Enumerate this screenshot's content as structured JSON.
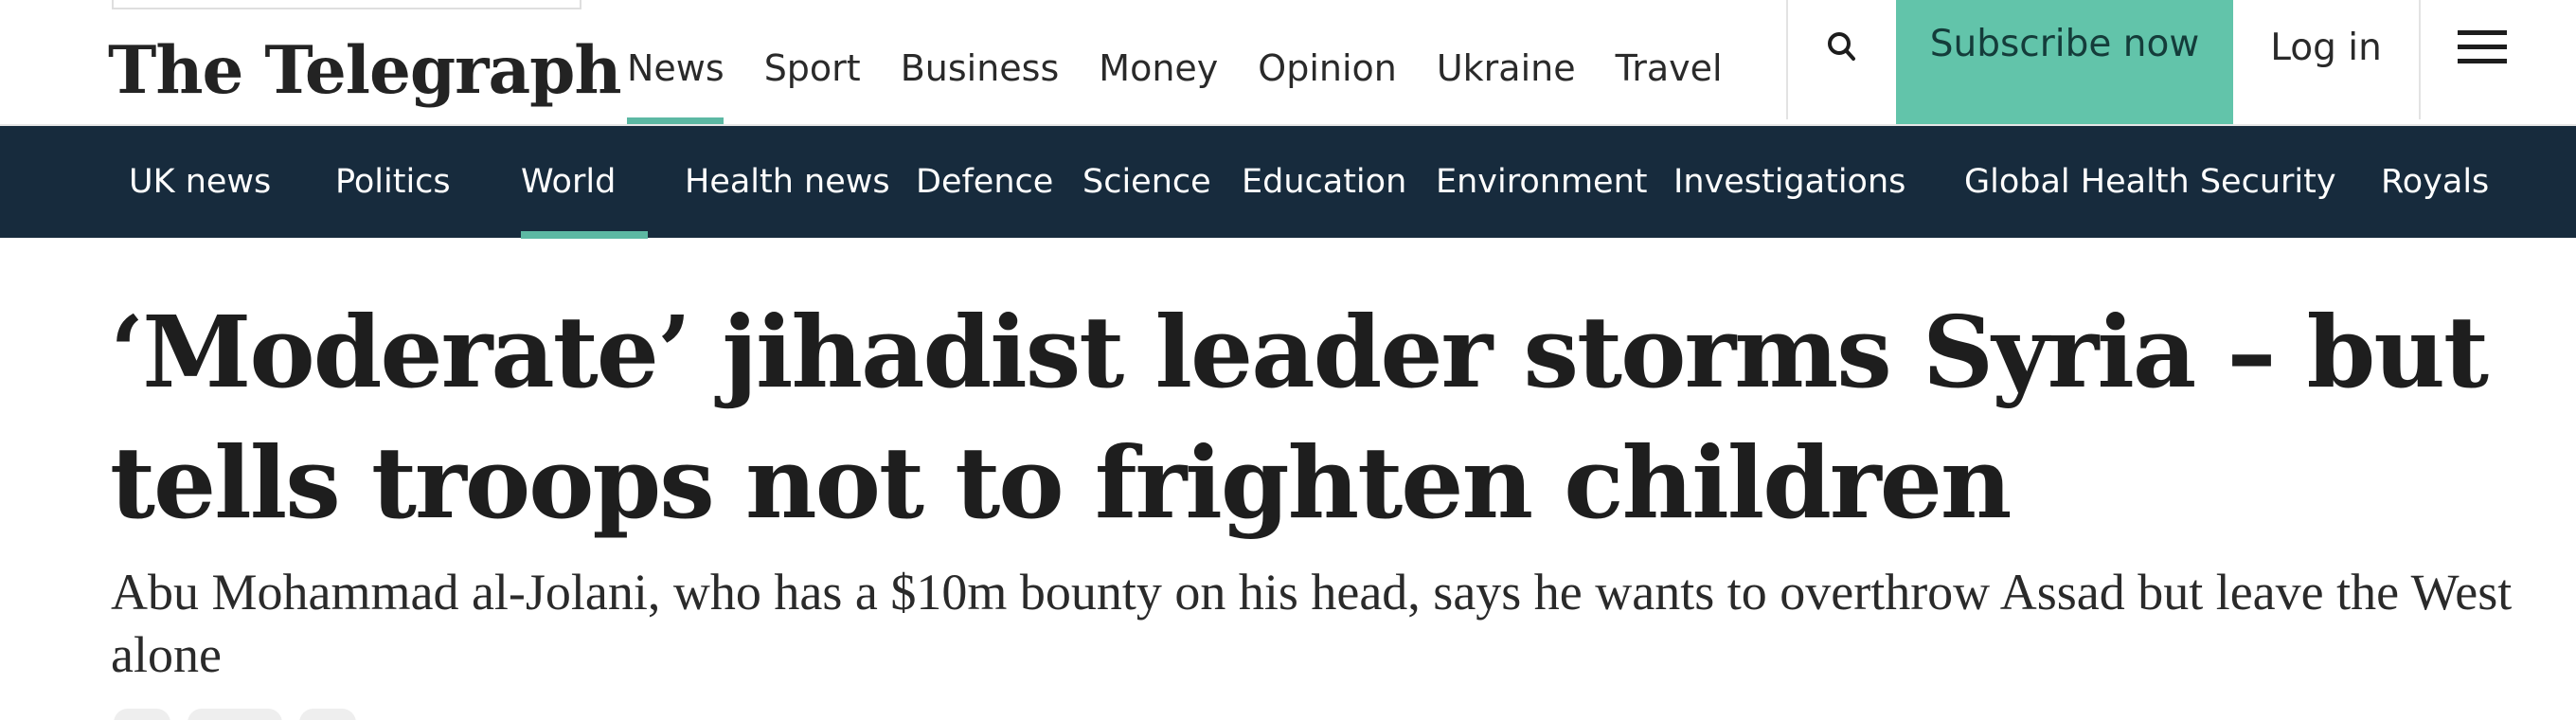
{
  "header": {
    "logo_text": "The Telegraph",
    "primary_nav": [
      {
        "label": "News",
        "active": true
      },
      {
        "label": "Sport"
      },
      {
        "label": "Business"
      },
      {
        "label": "Money"
      },
      {
        "label": "Opinion"
      },
      {
        "label": "Ukraine"
      },
      {
        "label": "Travel"
      }
    ],
    "search_icon": "search-icon",
    "subscribe_label": "Subscribe now",
    "login_label": "Log in",
    "menu_icon": "hamburger-menu-icon"
  },
  "section_nav": {
    "items": [
      {
        "label": "UK news"
      },
      {
        "label": "Politics"
      },
      {
        "label": "World",
        "active": true
      },
      {
        "label": "Health news"
      },
      {
        "label": "Defence"
      },
      {
        "label": "Science"
      },
      {
        "label": "Education"
      },
      {
        "label": "Environment"
      },
      {
        "label": "Investigations"
      },
      {
        "label": "Global Health Security"
      },
      {
        "label": "Royals"
      }
    ]
  },
  "article": {
    "headline": "‘Moderate’ jihadist leader storms Syria – but tells troops not to frighten children",
    "standfirst": "Abu Mohammad al-Jolani, who has a $10m bounty on his head, says he wants to overthrow Assad but leave the West alone"
  },
  "colors": {
    "section_nav_bg": "#172b3d",
    "accent_teal": "#5cb8a3",
    "subscribe_bg": "#62c4aa"
  }
}
